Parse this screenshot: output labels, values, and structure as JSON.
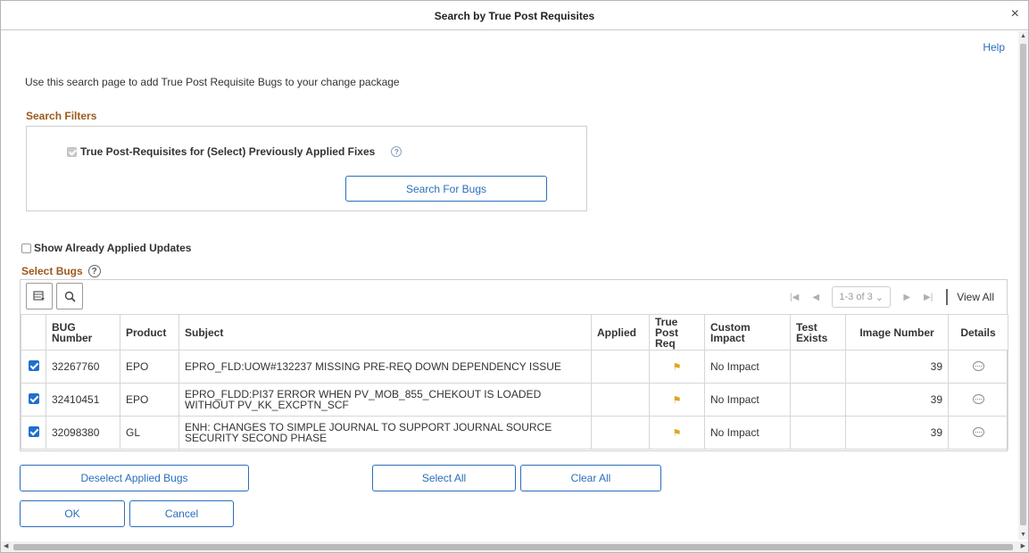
{
  "dialog": {
    "title": "Search by True Post Requisites",
    "close_symbol": "×"
  },
  "help_link": "Help",
  "intro_text": "Use this search page to add True Post Requisite Bugs to your change package",
  "search_filters": {
    "heading": "Search Filters",
    "checkbox_label": "True Post-Requisites for (Select) Previously Applied Fixes",
    "help_symbol": "?",
    "search_button": "Search For Bugs"
  },
  "show_applied_label": "Show Already Applied Updates",
  "select_bugs": {
    "heading": "Select Bugs",
    "help_symbol": "?",
    "pager": {
      "range": "1-3 of 3",
      "view_all": "View All"
    },
    "columns": {
      "bug_number": "BUG Number",
      "product": "Product",
      "subject": "Subject",
      "applied": "Applied",
      "true_post_req": "True Post Req",
      "custom_impact": "Custom Impact",
      "test_exists": "Test Exists",
      "image_number": "Image Number",
      "details": "Details"
    },
    "rows": [
      {
        "bug_number": "32267760",
        "product": "EPO",
        "subject": "EPRO_FLD:UOW#132237 MISSING PRE-REQ DOWN DEPENDENCY ISSUE",
        "applied": "",
        "custom_impact": "No Impact",
        "test_exists": "",
        "image_number": "39"
      },
      {
        "bug_number": "32410451",
        "product": "EPO",
        "subject": "EPRO_FLDD:PI37 ERROR WHEN PV_MOB_855_CHEKOUT IS LOADED WITHOUT PV_KK_EXCPTN_SCF",
        "applied": "",
        "custom_impact": "No Impact",
        "test_exists": "",
        "image_number": "39"
      },
      {
        "bug_number": "32098380",
        "product": "GL",
        "subject": "ENH: CHANGES TO SIMPLE JOURNAL TO SUPPORT JOURNAL SOURCE SECURITY SECOND PHASE",
        "applied": "",
        "custom_impact": "No Impact",
        "test_exists": "",
        "image_number": "39"
      }
    ]
  },
  "buttons": {
    "deselect_applied": "Deselect Applied Bugs",
    "select_all": "Select All",
    "clear_all": "Clear All",
    "ok": "OK",
    "cancel": "Cancel"
  },
  "colors": {
    "link_blue": "#2a6ebb",
    "section_heading": "#9c5a1e",
    "checkbox_blue": "#1f6fcf",
    "flag_yellow": "#e0a31c"
  },
  "icons": {
    "close": "close-icon",
    "grid_personalize": "grid-personalize-icon",
    "grid_find": "search-icon",
    "true_post_req": "flag-icon",
    "details": "chat-bubble-icon"
  }
}
